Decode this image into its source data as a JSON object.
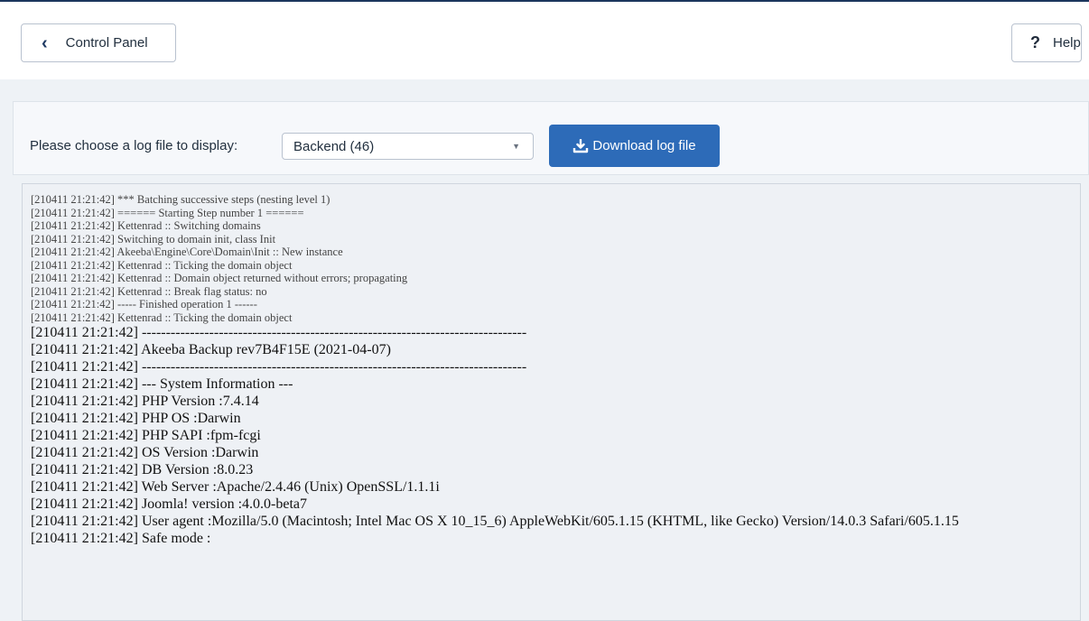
{
  "toolbar": {
    "back_label": "Control Panel",
    "back_icon": "chevron-left-icon",
    "help_label": "Help",
    "help_icon": "question-icon"
  },
  "controls": {
    "choose_label": "Please choose a log file to display:",
    "select_value": "Backend (46)",
    "download_label": "Download log file",
    "download_icon": "download-icon",
    "accent_color": "#2d6bb8"
  },
  "log": {
    "small_lines": [
      "[210411 21:21:42] *** Batching successive steps (nesting level 1)",
      "[210411 21:21:42] ====== Starting Step number 1 ======",
      "[210411 21:21:42] Kettenrad :: Switching domains",
      "[210411 21:21:42] Switching to domain init, class Init",
      "[210411 21:21:42] Akeeba\\Engine\\Core\\Domain\\Init :: New instance",
      "[210411 21:21:42] Kettenrad :: Ticking the domain object",
      "[210411 21:21:42] Kettenrad :: Domain object returned without errors; propagating",
      "[210411 21:21:42] Kettenrad :: Break flag status: no",
      "[210411 21:21:42] ----- Finished operation 1 ------",
      "[210411 21:21:42] Kettenrad :: Ticking the domain object"
    ],
    "big_lines": [
      "[210411 21:21:42] --------------------------------------------------------------------------------",
      "[210411 21:21:42] Akeeba Backup rev7B4F15E (2021-04-07)",
      "[210411 21:21:42] --------------------------------------------------------------------------------",
      "[210411 21:21:42] --- System Information ---",
      "[210411 21:21:42] PHP Version :7.4.14",
      "[210411 21:21:42] PHP OS :Darwin",
      "[210411 21:21:42] PHP SAPI :fpm-fcgi",
      "[210411 21:21:42] OS Version :Darwin",
      "[210411 21:21:42] DB Version :8.0.23",
      "[210411 21:21:42] Web Server :Apache/2.4.46 (Unix) OpenSSL/1.1.1i",
      "[210411 21:21:42] Joomla! version :4.0.0-beta7",
      "[210411 21:21:42] User agent :Mozilla/5.0 (Macintosh; Intel Mac OS X 10_15_6) AppleWebKit/605.1.15 (KHTML, like Gecko) Version/14.0.3 Safari/605.1.15",
      "[210411 21:21:42] Safe mode :"
    ]
  }
}
